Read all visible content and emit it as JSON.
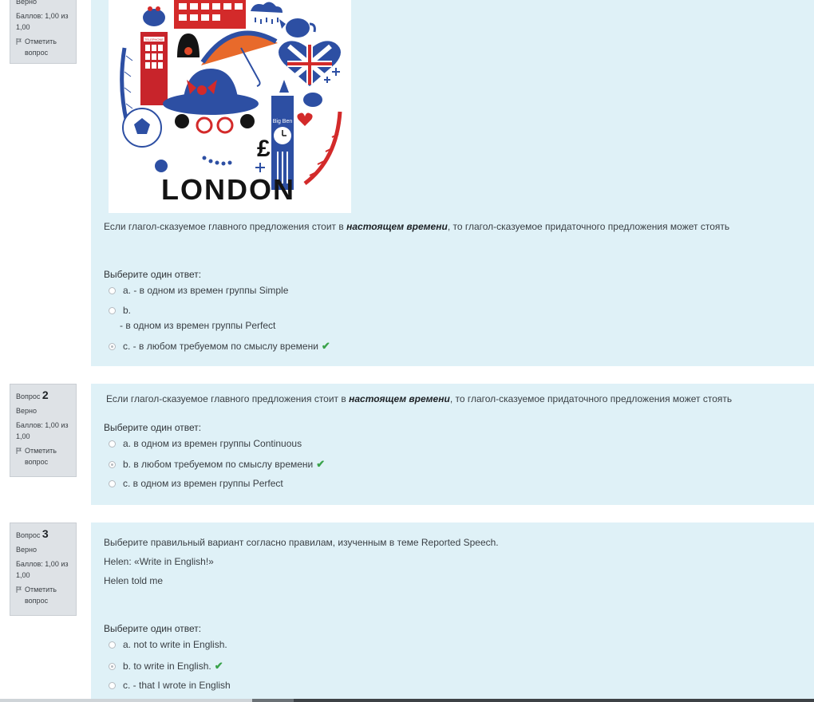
{
  "q1": {
    "status_top": "Верно",
    "score": "Баллов: 1,00 из 1,00",
    "flag": "Отметить вопрос",
    "image_text": {
      "telephone": "TELEPHONE",
      "big_ben": "Big Ben",
      "london": "LONDON",
      "pound": "£"
    },
    "question_prefix": "Если глагол-сказуемое главного предложения стоит в ",
    "question_emph": "настоящем времени",
    "question_suffix": ", то глагол-сказуемое придаточного предложения может стоять",
    "prompt": "Выберите один ответ:",
    "options": [
      {
        "label": "a. - в одном из времен группы Simple"
      },
      {
        "label": "b.",
        "sub": "- в одном из времен группы Perfect"
      },
      {
        "label": "c. - в любом требуемом по смыслу времени",
        "check": "✔"
      }
    ]
  },
  "q2": {
    "label": "Вопрос",
    "number": "2",
    "status": "Верно",
    "score": "Баллов: 1,00 из 1,00",
    "flag": "Отметить вопрос",
    "question_prefix": "Если глагол-сказуемое главного предложения стоит в ",
    "question_emph": "настоящем времени",
    "question_suffix": ", то глагол-сказуемое придаточного предложения может стоять",
    "prompt": "Выберите один ответ:",
    "options": [
      {
        "label": "a. в одном из времен группы Continuous"
      },
      {
        "label": "b. в любом требуемом по смыслу времени",
        "check": "✔"
      },
      {
        "label": "c. в одном из времен группы Perfect"
      }
    ]
  },
  "q3": {
    "label": "Вопрос",
    "number": "3",
    "status": "Верно",
    "score": "Баллов: 1,00 из 1,00",
    "flag": "Отметить вопрос",
    "question_line1": "Выберите правильный вариант согласно правилам, изученным в теме Reported Speech.",
    "question_line2": "Helen: «Write in English!»",
    "question_line3": "Helen told me",
    "prompt": "Выберите один ответ:",
    "options": [
      {
        "label": "a. not to write in English."
      },
      {
        "label": "b. to write in English.",
        "check": "✔"
      },
      {
        "label": "c. - that I wrote in English"
      }
    ]
  }
}
